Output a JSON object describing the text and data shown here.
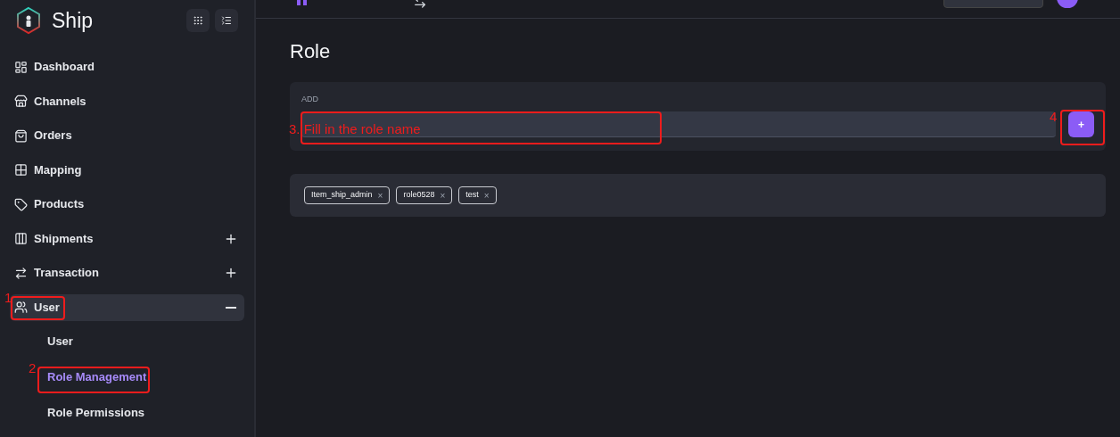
{
  "brand": {
    "name": "Ship"
  },
  "sidebar": {
    "items": [
      {
        "label": "Dashboard",
        "kind": "link",
        "selected": false
      },
      {
        "label": "Channels",
        "kind": "link",
        "selected": false
      },
      {
        "label": "Orders",
        "kind": "link",
        "selected": false
      },
      {
        "label": "Mapping",
        "kind": "link",
        "selected": false
      },
      {
        "label": "Products",
        "kind": "link",
        "selected": false
      },
      {
        "label": "Shipments",
        "kind": "group",
        "expanded": false,
        "selected": false
      },
      {
        "label": "Transaction",
        "kind": "group",
        "expanded": false,
        "selected": false
      },
      {
        "label": "User",
        "kind": "group",
        "expanded": true,
        "selected": true,
        "children": [
          {
            "label": "User",
            "selected": false
          },
          {
            "label": "Role Management",
            "selected": true
          },
          {
            "label": "Role Permissions",
            "selected": false
          }
        ]
      }
    ]
  },
  "page": {
    "title": "Role",
    "add_card": {
      "label": "ADD",
      "button": "+"
    },
    "roles": [
      {
        "label": "Item_ship_admin",
        "remove": "×"
      },
      {
        "label": "role0528",
        "remove": "×"
      },
      {
        "label": "test",
        "remove": "×"
      }
    ]
  },
  "annotations": [
    "1",
    "2",
    "3. Fill in the role name",
    "4"
  ]
}
